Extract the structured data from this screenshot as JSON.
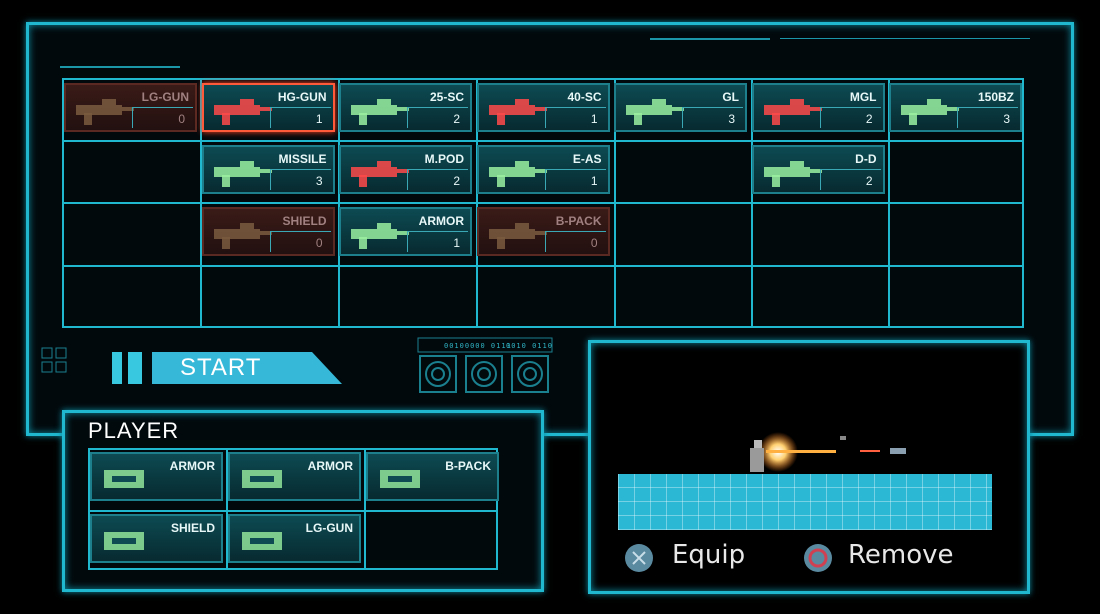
{
  "inventory": {
    "rows": [
      [
        {
          "name": "LG-GUN",
          "count": "0",
          "state": "dim",
          "color": "#7a5a40"
        },
        {
          "name": "HG-GUN",
          "count": "1",
          "state": "selected",
          "color": "#ff4a4a"
        },
        {
          "name": "25-SC",
          "count": "2",
          "state": "normal",
          "color": "#9af0a0"
        },
        {
          "name": "40-SC",
          "count": "1",
          "state": "normal",
          "color": "#ff4a4a"
        },
        {
          "name": "GL",
          "count": "3",
          "state": "normal",
          "color": "#9af0a0"
        },
        {
          "name": "MGL",
          "count": "2",
          "state": "normal",
          "color": "#ff4a4a"
        },
        {
          "name": "150BZ",
          "count": "3",
          "state": "normal",
          "color": "#9af0a0"
        }
      ],
      [
        null,
        {
          "name": "MISSILE",
          "count": "3",
          "state": "normal",
          "color": "#9af0a0"
        },
        {
          "name": "M.POD",
          "count": "2",
          "state": "normal",
          "color": "#ff4a4a"
        },
        {
          "name": "E-AS",
          "count": "1",
          "state": "normal",
          "color": "#9af0a0"
        },
        null,
        {
          "name": "D-D",
          "count": "2",
          "state": "normal",
          "color": "#9af0a0"
        },
        null
      ],
      [
        null,
        {
          "name": "SHIELD",
          "count": "0",
          "state": "dim",
          "color": "#7a5a40"
        },
        {
          "name": "ARMOR",
          "count": "1",
          "state": "normal",
          "color": "#9af0a0"
        },
        {
          "name": "B-PACK",
          "count": "0",
          "state": "dim",
          "color": "#7a5a40"
        },
        null,
        null,
        null
      ]
    ]
  },
  "start": {
    "label": "START"
  },
  "player": {
    "title": "PLAYER",
    "slots": [
      {
        "name": "ARMOR"
      },
      {
        "name": "ARMOR"
      },
      {
        "name": "B-PACK"
      },
      {
        "name": "SHIELD"
      },
      {
        "name": "LG-GUN"
      }
    ]
  },
  "deco": {
    "code1": "00100000 0111",
    "code2": "0010 0110"
  },
  "controls": {
    "equip": {
      "label": "Equip",
      "icon": "cross-button-icon"
    },
    "remove": {
      "label": "Remove",
      "icon": "circle-button-icon"
    }
  },
  "colors": {
    "accent": "#1fb8cf",
    "selected": "#ff5a3a",
    "equip_glyph": "#5a8aa0",
    "remove_glyph": "#d04050"
  }
}
